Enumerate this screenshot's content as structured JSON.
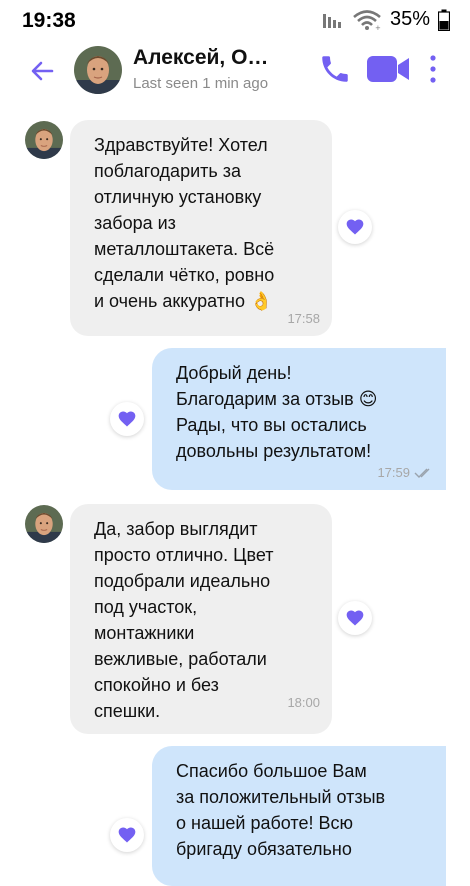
{
  "status_bar": {
    "time": "19:38",
    "battery": "35%"
  },
  "header": {
    "contact_name": "Алексей, О…",
    "last_seen": "Last seen 1 min ago"
  },
  "colors": {
    "accent": "#7360f2",
    "incoming_bubble": "#efefef",
    "outgoing_bubble": "#cfe5fb"
  },
  "messages": [
    {
      "direction": "incoming",
      "text": "Здравствуйте! Хотел\nпоблагодарить за\nотличную установку\nзабора из\nметаллоштакета. Всё\nсделали чётко, ровно\nи очень аккуратно 👌",
      "time": "17:58"
    },
    {
      "direction": "outgoing",
      "text": "Добрый день!\nБлагодарим за отзыв 😊\nРады, что вы остались\nдовольны результатом!",
      "time": "17:59"
    },
    {
      "direction": "incoming",
      "text": "Да, забор выглядит\nпросто отлично. Цвет\nподобрали идеально\nпод участок,\nмонтажники\nвежливые, работали\nспокойно и без\nспешки.",
      "time": "18:00"
    },
    {
      "direction": "outgoing",
      "text": "Спасибо большое Вам\nза положительный отзыв\nо нашей работе! Всю\nбригаду обязательно",
      "time": ""
    }
  ]
}
